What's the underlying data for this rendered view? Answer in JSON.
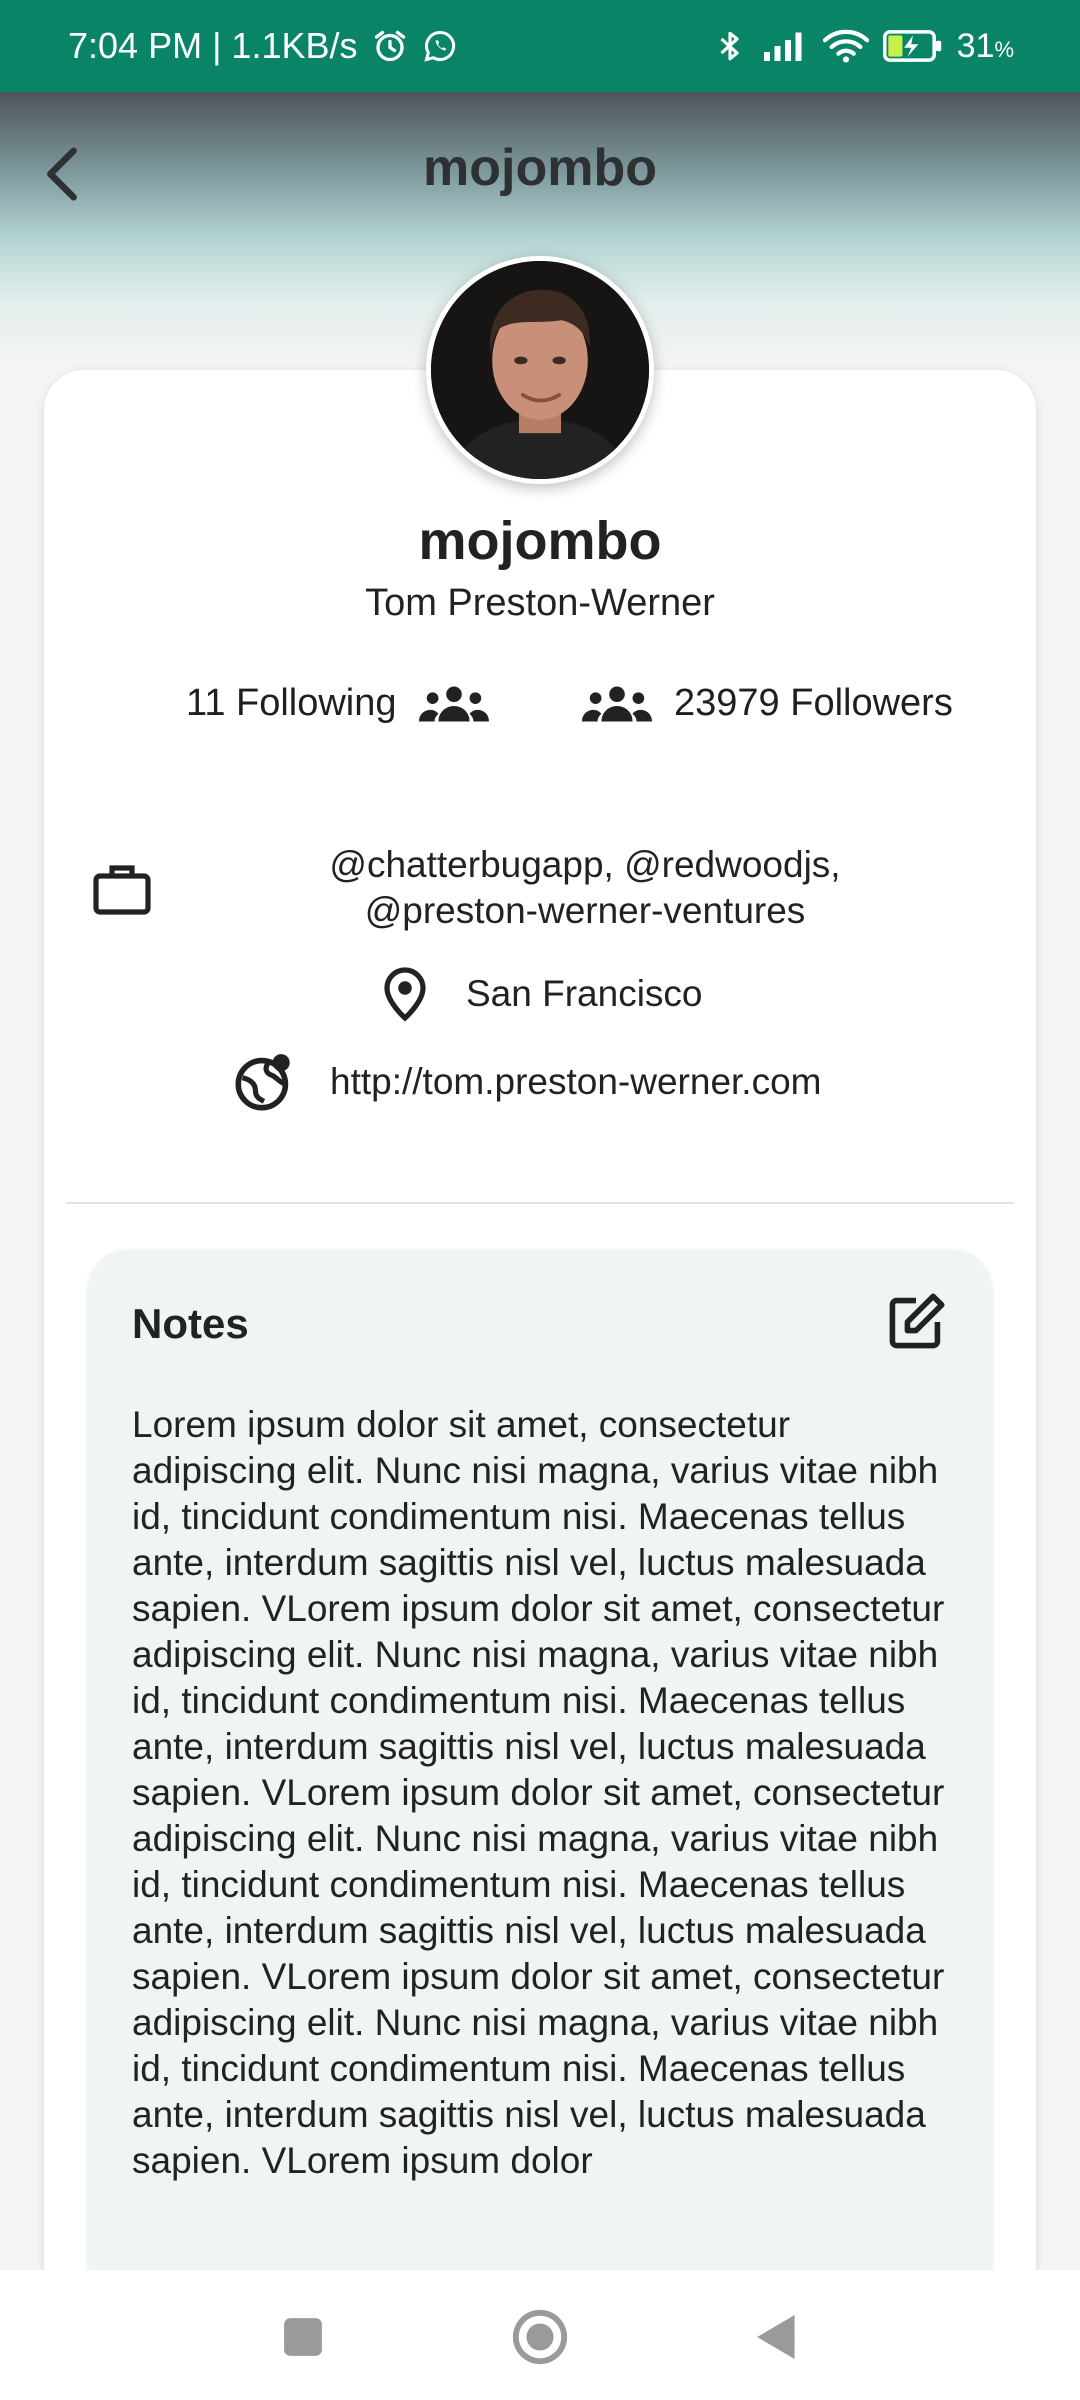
{
  "status_bar": {
    "time_speed": "7:04 PM | 1.1KB/s",
    "battery": "31",
    "battery_unit": "%",
    "icons": [
      "alarm-icon",
      "whatsapp-icon",
      "bluetooth-icon",
      "signal-icon",
      "wifi-icon",
      "battery-charging-icon"
    ]
  },
  "header": {
    "title": "mojombo",
    "back_icon": "chevron-left-icon"
  },
  "profile": {
    "avatar_icon": "avatar",
    "username": "mojombo",
    "full_name": "Tom Preston-Werner",
    "following_label": "11 Following",
    "followers_label": "23979 Followers",
    "company_line1": "@chatterbugapp, @redwoodjs,",
    "company_line2": "@preston-werner-ventures",
    "location": "San Francisco",
    "website": "http://tom.preston-werner.com"
  },
  "notes": {
    "title": "Notes",
    "edit_icon": "edit-icon",
    "body": "Lorem ipsum dolor sit amet, consectetur adipiscing elit. Nunc nisi magna, varius vitae nibh id, tincidunt condimentum nisi. Maecenas tellus ante, interdum sagittis nisl vel, luctus malesuada sapien. VLorem ipsum dolor sit amet, consectetur adipiscing elit. Nunc nisi magna, varius vitae nibh id, tincidunt condimentum nisi. Maecenas tellus ante, interdum sagittis nisl vel, luctus malesuada sapien. VLorem ipsum dolor sit amet, consectetur adipiscing elit. Nunc nisi magna, varius vitae nibh id, tincidunt condimentum nisi. Maecenas tellus ante, interdum sagittis nisl vel, luctus malesuada sapien. VLorem ipsum dolor sit amet, consectetur adipiscing elit. Nunc nisi magna, varius vitae nibh id, tincidunt condimentum nisi. Maecenas tellus ante, interdum sagittis nisl vel, luctus malesuada sapien. VLorem ipsum dolor"
  },
  "colors": {
    "status_bar": "#0a8467",
    "notes_background": "#eff5f4",
    "card_background": "#ffffff"
  },
  "nav_bar": {
    "icons": [
      "recents-icon",
      "home-icon",
      "back-icon"
    ]
  }
}
